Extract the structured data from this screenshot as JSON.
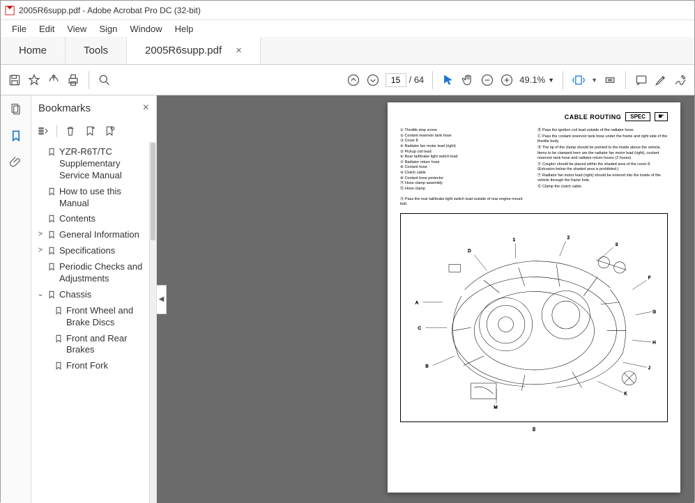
{
  "title_bar": "2005R6supp.pdf - Adobe Acrobat Pro DC (32-bit)",
  "menu": [
    "File",
    "Edit",
    "View",
    "Sign",
    "Window",
    "Help"
  ],
  "tabs": {
    "home": "Home",
    "tools": "Tools",
    "file": "2005R6supp.pdf"
  },
  "page_info": {
    "current": "15",
    "total": "64"
  },
  "zoom": "49.1%",
  "bookmarks_panel": {
    "title": "Bookmarks"
  },
  "bookmarks": [
    {
      "indent": 0,
      "chev": "",
      "label": "YZR-R6T/TC Supplementary Service Manual"
    },
    {
      "indent": 0,
      "chev": "",
      "label": "How to use this Manual"
    },
    {
      "indent": 0,
      "chev": "",
      "label": "Contents"
    },
    {
      "indent": 0,
      "chev": ">",
      "label": "General Information"
    },
    {
      "indent": 0,
      "chev": ">",
      "label": "Specifications"
    },
    {
      "indent": 0,
      "chev": "",
      "label": "Periodic Checks and Adjustments"
    },
    {
      "indent": 0,
      "chev": "v",
      "label": "Chassis"
    },
    {
      "indent": 1,
      "chev": "",
      "label": "Front Wheel and Brake Discs"
    },
    {
      "indent": 1,
      "chev": "",
      "label": "Front and Rear Brakes"
    },
    {
      "indent": 1,
      "chev": "",
      "label": "Front Fork"
    }
  ],
  "doc": {
    "header_title": "CABLE ROUTING",
    "spec": "SPEC",
    "left_col": [
      "① Throttle stop screw",
      "② Coolant reservoir tank hose",
      "③ Cover 8",
      "④ Radiator fan motor lead (right)",
      "⑤ Pickup coil lead",
      "⑥ Rear tail/brake light switch lead",
      "⑦ Radiator return hose",
      "⑧ Coolant hose",
      "⑨ Clutch cable",
      "⑩ Coolant hose protector",
      "⑪ Hose clamp assembly",
      "⑫ Hose clamp",
      "",
      "Ⓐ Pass the rear tail/brake light switch lead outside of rear engine mount bolt."
    ],
    "right_col": [
      "Ⓑ Pass the ignition coil lead outside of the radiator hose.",
      "Ⓒ Pass the coolant reservoir tank hose under the frame and right side of the throttle body.",
      "Ⓓ The tip of the clamp should be pointed to the inside above the vehicle. Items to be clamped here are the radiator fan motor lead (right), coolant reservoir tank hose and radiator return hoses (2 hoses).",
      "Ⓔ Coupler should be placed within the shaded area of the cover 8. (Extrusion below the shaded area is prohibited.)",
      "Ⓕ Radiator fan motor lead (right) should be entered into the inside of the vehicle through the frame hole.",
      "Ⓖ Clamp the clutch cable."
    ],
    "page_num": "8"
  }
}
